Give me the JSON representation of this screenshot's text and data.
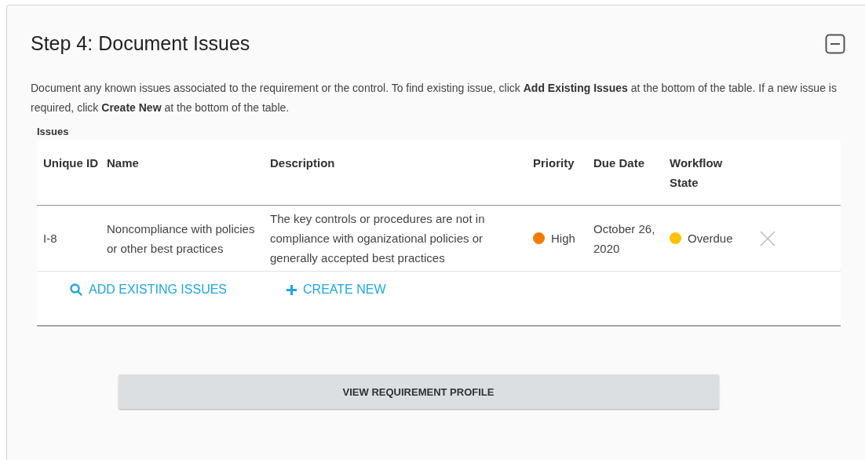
{
  "section": {
    "title": "Step 4: Document Issues",
    "collapse_control": true,
    "description": "Document any known issues associated to the requirement or the control. To find existing issue, click **Add Existing Issues** at the bottom of the table. If a new issue is required, click **Create New** at the bottom of the table."
  },
  "issues_table": {
    "label": "Issues",
    "columns": [
      "Unique ID",
      "Name",
      "Description",
      "Priority",
      "Due Date",
      "Workflow State"
    ],
    "rows": [
      {
        "unique_id": "I-8",
        "name": "Noncompliance with policies or other best practices",
        "description": "The key controls or procedures are not in compliance with oganizational policies or generally accepted best practices",
        "priority": {
          "label": "High",
          "color": "#f57c00"
        },
        "due_date": "October 26, 2020",
        "workflow_state": {
          "label": "Overdue",
          "color": "#ffc107"
        }
      }
    ],
    "actions": [
      {
        "kind": "search",
        "label": "ADD EXISTING ISSUES"
      },
      {
        "kind": "add",
        "label": "CREATE NEW"
      }
    ]
  },
  "footer_button": "VIEW REQUIREMENT PROFILE"
}
